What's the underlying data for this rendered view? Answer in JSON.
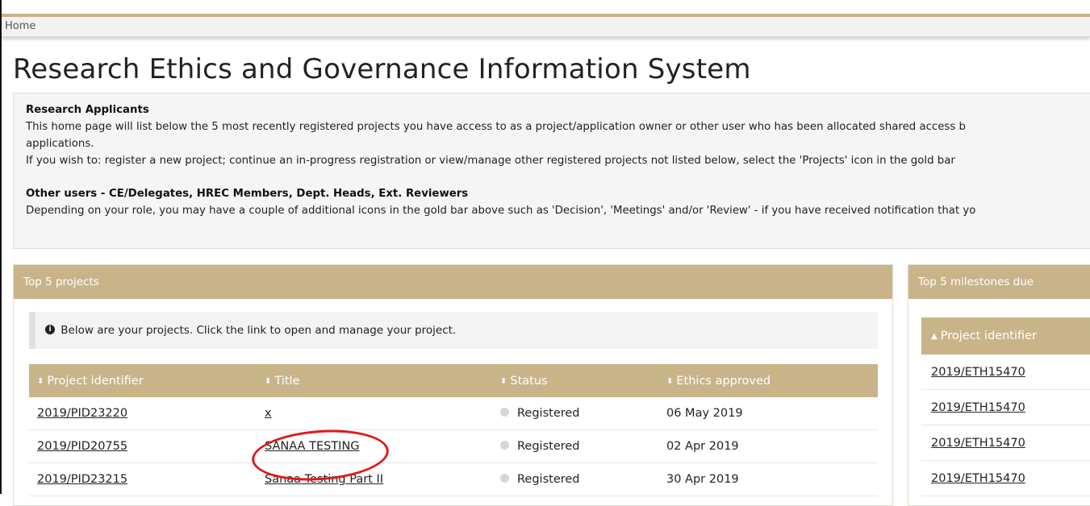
{
  "breadcrumb": {
    "home": "Home"
  },
  "page_title": "Research Ethics and Governance Information System",
  "info": {
    "applicants_heading": "Research Applicants",
    "applicants_line1": "This home page will list below the 5 most recently registered projects you have access to as a project/application owner or other user who has been allocated shared access b",
    "applicants_line2": "applications.",
    "applicants_line3": "If you wish to: register a new project; continue an in-progress registration or view/manage other registered projects not listed below, select the 'Projects' icon in the gold bar",
    "other_heading": "Other users - CE/Delegates, HREC Members, Dept. Heads, Ext. Reviewers",
    "other_line1": "Depending on your role, you may have a couple of additional icons in the gold bar above such as 'Decision', 'Meetings' and/or 'Review' - if you have received notification that yo"
  },
  "projects_panel": {
    "title": "Top 5 projects",
    "note": "Below are your projects. Click the link to open and manage your project.",
    "columns": [
      "Project identifier",
      "Title",
      "Status",
      "Ethics approved"
    ],
    "rows": [
      {
        "id": "2019/PID23220",
        "title": "x",
        "status": "Registered",
        "approved": "06 May 2019"
      },
      {
        "id": "2019/PID20755",
        "title": "SANAA TESTING",
        "status": "Registered",
        "approved": "02 Apr 2019"
      },
      {
        "id": "2019/PID23215",
        "title": "Sanaa Testing Part II",
        "status": "Registered",
        "approved": "30 Apr 2019"
      }
    ]
  },
  "milestones_panel": {
    "title": "Top 5 milestones due",
    "column": "Project identifier",
    "rows": [
      "2019/ETH15470",
      "2019/ETH15470",
      "2019/ETH15470",
      "2019/ETH15470"
    ]
  },
  "colors": {
    "gold": "#c9b48a",
    "annotation_red": "#e0191a"
  },
  "icons": {
    "info": "info-circle-icon",
    "sort": "sort-icon",
    "sort_up": "caret-up-icon",
    "status": "status-dot-icon"
  }
}
